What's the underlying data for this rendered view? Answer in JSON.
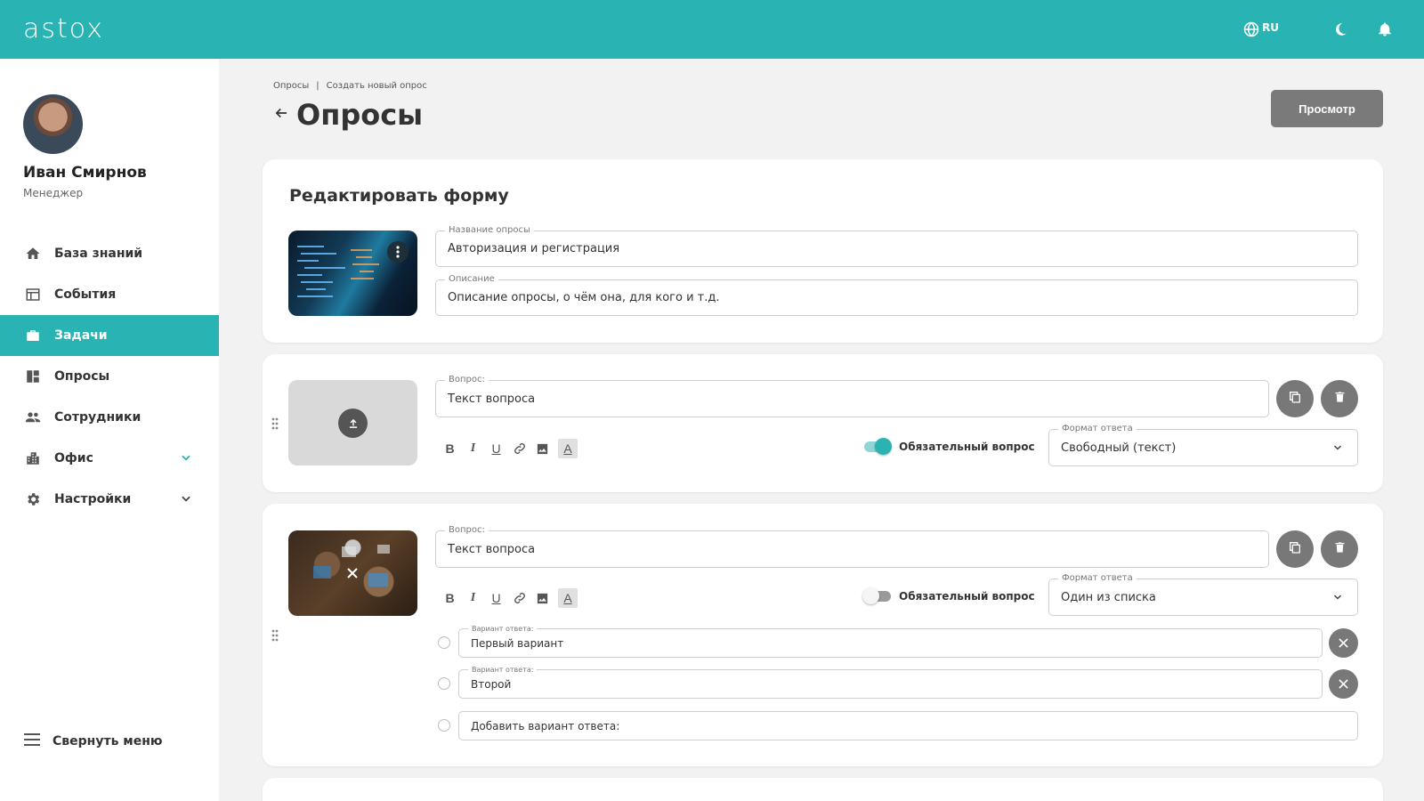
{
  "app": {
    "logo": "astox",
    "lang": "RU"
  },
  "user": {
    "name": "Иван Смирнов",
    "role": "Менеджер"
  },
  "sidebar": {
    "items": [
      {
        "label": "База знаний",
        "icon": "home-icon"
      },
      {
        "label": "События",
        "icon": "calendar-icon"
      },
      {
        "label": "Задачи",
        "icon": "briefcase-icon",
        "active": true
      },
      {
        "label": "Опросы",
        "icon": "dashboard-icon"
      },
      {
        "label": "Сотрудники",
        "icon": "people-icon"
      },
      {
        "label": "Офис",
        "icon": "building-icon",
        "expandable": true
      },
      {
        "label": "Настройки",
        "icon": "gear-icon",
        "expandable": true
      }
    ],
    "collapse_label": "Свернуть меню"
  },
  "breadcrumb": {
    "root": "Опросы",
    "separator": "|",
    "current": "Создать новый опрос"
  },
  "page": {
    "title": "Опросы",
    "preview_label": "Просмотр"
  },
  "form": {
    "heading": "Редактировать форму",
    "name_label": "Название опросы",
    "name_value": "Авторизация и регистрация",
    "description_label": "Описание",
    "description_value": "Описание опросы, о чём она, для кого и т.д."
  },
  "questions": [
    {
      "question_label": "Вопрос:",
      "question_value": "Текст вопроса",
      "required_label": "Обязательный вопрос",
      "required": true,
      "format_label": "Формат ответа",
      "format_value": "Свободный (текст)"
    },
    {
      "question_label": "Вопрос:",
      "question_value": "Текст вопроса",
      "required_label": "Обязательный вопрос",
      "required": false,
      "format_label": "Формат ответа",
      "format_value": "Один из списка",
      "options": [
        {
          "label": "Вариант ответа:",
          "value": "Первый вариант"
        },
        {
          "label": "Вариант ответа:",
          "value": "Второй"
        }
      ],
      "add_option_placeholder": "Добавить вариант ответа:"
    }
  ],
  "colors": {
    "accent": "#2ab3b3",
    "button_gray": "#787878",
    "background": "#f2f2f2"
  }
}
